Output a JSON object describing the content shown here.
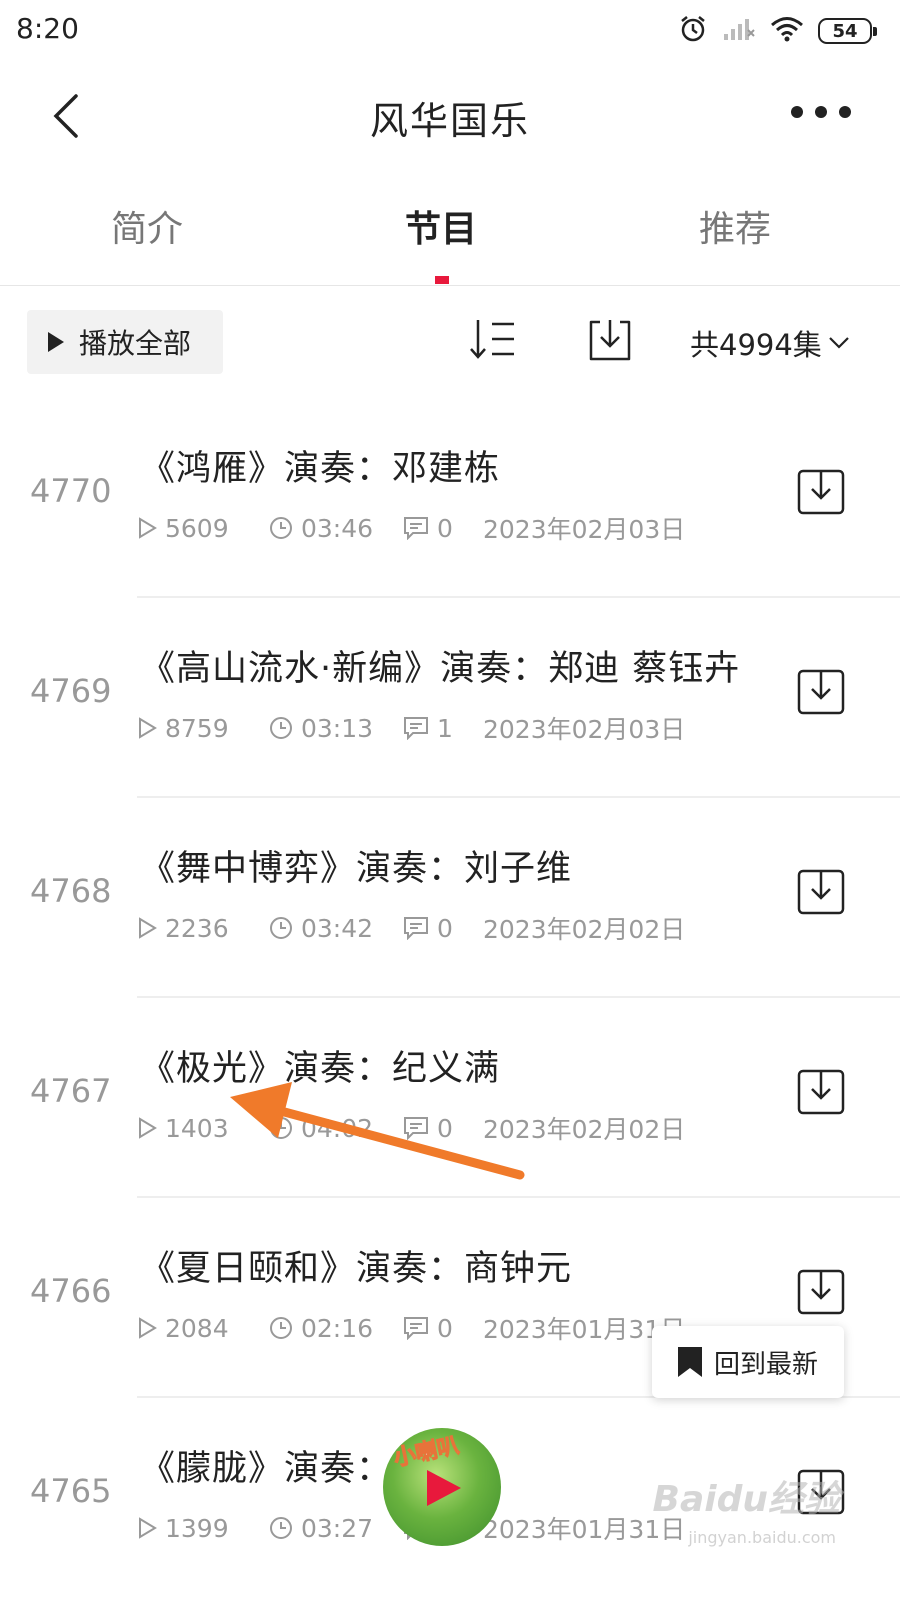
{
  "status_bar": {
    "time": "8:20",
    "battery": "54"
  },
  "header": {
    "title": "风华国乐"
  },
  "tabs": [
    {
      "label": "简介"
    },
    {
      "label": "节目"
    },
    {
      "label": "推荐"
    }
  ],
  "toolbar": {
    "play_all_label": "播放全部",
    "count_label": "共4994集"
  },
  "episodes": [
    {
      "index": "4770",
      "title": "《鸿雁》演奏：邓建栋",
      "plays": "5609",
      "duration": "03:46",
      "comments": "0",
      "date": "2023年02月03日"
    },
    {
      "index": "4769",
      "title": "《高山流水·新编》演奏：郑迪 蔡钰卉",
      "plays": "8759",
      "duration": "03:13",
      "comments": "1",
      "date": "2023年02月03日"
    },
    {
      "index": "4768",
      "title": "《舞中博弈》演奏：刘子维",
      "plays": "2236",
      "duration": "03:42",
      "comments": "0",
      "date": "2023年02月02日"
    },
    {
      "index": "4767",
      "title": "《极光》演奏：纪义满",
      "plays": "1403",
      "duration": "04:02",
      "comments": "0",
      "date": "2023年02月02日"
    },
    {
      "index": "4766",
      "title": "《夏日颐和》演奏：商钟元",
      "plays": "2084",
      "duration": "02:16",
      "comments": "0",
      "date": "2023年01月31日"
    },
    {
      "index": "4765",
      "title": "《朦胧》演奏：",
      "plays": "1399",
      "duration": "03:27",
      "comments": "",
      "date": "2023年01月31日"
    }
  ],
  "floating": {
    "back_to_latest_label": "回到最新",
    "mini_player_label": "小喇叭"
  },
  "watermark": {
    "brand": "Baidu经验",
    "url": "jingyan.baidu.com"
  },
  "colors": {
    "accent": "#e8193c",
    "annotation_arrow": "#f07a2a"
  }
}
